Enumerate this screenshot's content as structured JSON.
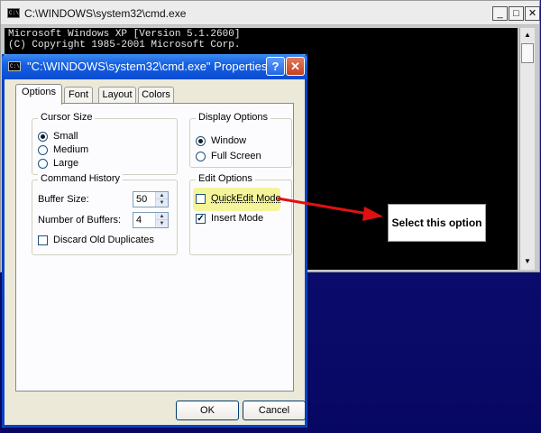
{
  "console": {
    "title": "C:\\WINDOWS\\system32\\cmd.exe",
    "icon": "cmd-icon",
    "icon_text": "C:\\",
    "minimize": "_",
    "maximize": "□",
    "close": "✕",
    "lines": [
      "Microsoft Windows XP [Version 5.1.2600]",
      "(C) Copyright 1985-2001 Microsoft Corp."
    ],
    "scroll_up": "▲",
    "scroll_down": "▼"
  },
  "dialog": {
    "title": "\"C:\\WINDOWS\\system32\\cmd.exe\" Properties",
    "icon_text": "C:\\",
    "help": "?",
    "close": "✕",
    "tabs": [
      {
        "label": "Options",
        "active": true
      },
      {
        "label": "Font",
        "active": false
      },
      {
        "label": "Layout",
        "active": false
      },
      {
        "label": "Colors",
        "active": false
      }
    ],
    "cursor_size": {
      "legend": "Cursor Size",
      "options": [
        {
          "label": "Small",
          "selected": true
        },
        {
          "label": "Medium",
          "selected": false
        },
        {
          "label": "Large",
          "selected": false
        }
      ]
    },
    "display_options": {
      "legend": "Display Options",
      "options": [
        {
          "label": "Window",
          "selected": true
        },
        {
          "label": "Full Screen",
          "selected": false
        }
      ]
    },
    "command_history": {
      "legend": "Command History",
      "buffer_size_label": "Buffer Size:",
      "buffer_size_value": "50",
      "num_buffers_label": "Number of Buffers:",
      "num_buffers_value": "4",
      "discard_label": "Discard Old Duplicates",
      "discard_checked": false
    },
    "edit_options": {
      "legend": "Edit Options",
      "quickedit_label": "QuickEdit Mode",
      "quickedit_checked": false,
      "insert_label": "Insert Mode",
      "insert_checked": true
    },
    "ok_label": "OK",
    "cancel_label": "Cancel",
    "colors": {
      "titlebar": "#0a4bd0",
      "face": "#ece9d8",
      "highlight": "#f4f59a"
    }
  },
  "callout": {
    "text": "Select this option",
    "arrow_color": "#e01010"
  }
}
